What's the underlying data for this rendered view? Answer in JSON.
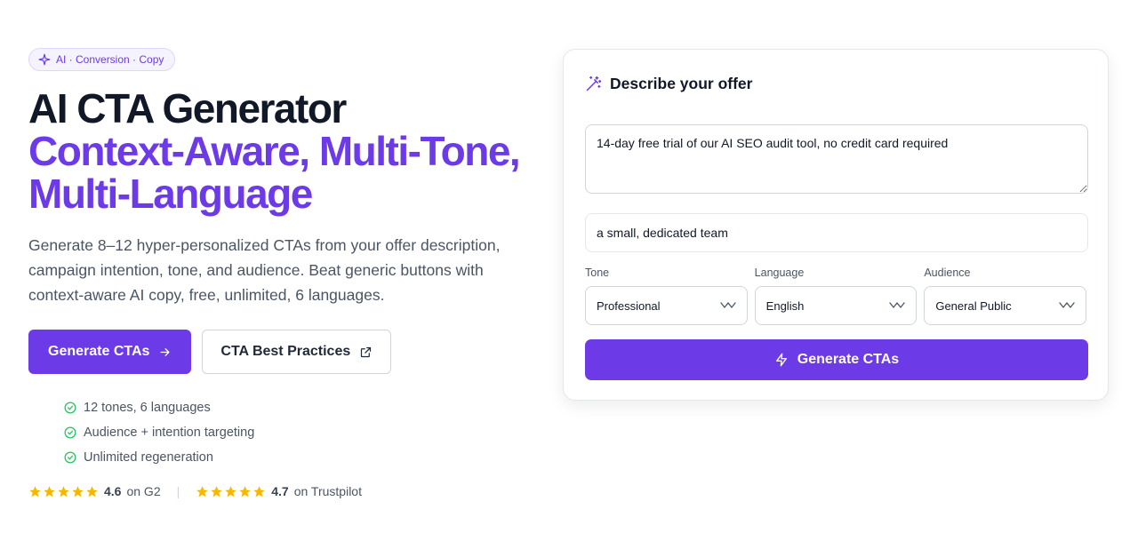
{
  "hero": {
    "badge": "AI · Conversion · Copy",
    "title_line1": "AI CTA Generator",
    "title_line2": "Context-Aware, Multi-Tone, Multi-Language",
    "description": "Generate 8–12 hyper-personalized CTAs from your offer description, campaign intention, tone, and audience. Beat generic buttons with context-aware AI copy, free, unlimited, 6 languages.",
    "primary_button": "Generate CTAs",
    "secondary_button": "CTA Best Practices",
    "features": [
      "12 tones, 6 languages",
      "Audience + intention targeting",
      "Unlimited regeneration"
    ],
    "ratings": [
      {
        "score": "4.6",
        "source": "on G2",
        "stars": 5
      },
      {
        "score": "4.7",
        "source": "on Trustpilot",
        "stars": 5
      }
    ],
    "rating_separator": "|"
  },
  "form": {
    "title": "Describe your offer",
    "offer_value": "14-day free trial of our AI SEO audit tool, no credit card required",
    "context_value": "a small, dedicated team",
    "tone_label": "Tone",
    "tone_value": "Professional",
    "language_label": "Language",
    "language_value": "English",
    "audience_label": "Audience",
    "audience_value": "General Public",
    "submit_label": "Generate CTAs"
  },
  "colors": {
    "accent": "#6d3ae8",
    "check": "#22c55e",
    "star": "#f5b800"
  }
}
